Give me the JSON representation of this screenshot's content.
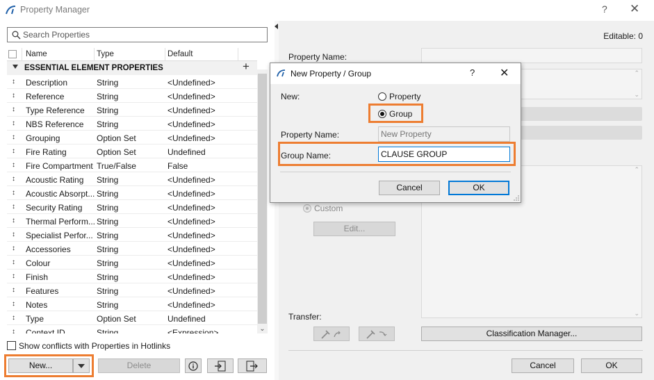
{
  "window": {
    "title": "Property Manager",
    "help_label": "?",
    "close_label": "✕"
  },
  "search": {
    "placeholder": "Search Properties"
  },
  "table": {
    "columns": {
      "name": "Name",
      "type": "Type",
      "default": "Default"
    },
    "group": {
      "label": "ESSENTIAL ELEMENT PROPERTIES",
      "add_label": "+"
    },
    "rows": [
      {
        "name": "Description",
        "type": "String",
        "default": "<Undefined>"
      },
      {
        "name": "Reference",
        "type": "String",
        "default": "<Undefined>"
      },
      {
        "name": "Type Reference",
        "type": "String",
        "default": "<Undefined>"
      },
      {
        "name": "NBS Reference",
        "type": "String",
        "default": "<Undefined>"
      },
      {
        "name": "Grouping",
        "type": "Option Set",
        "default": "<Undefined>"
      },
      {
        "name": "Fire Rating",
        "type": "Option Set",
        "default": "Undefined"
      },
      {
        "name": "Fire Compartment",
        "type": "True/False",
        "default": "False"
      },
      {
        "name": "Acoustic Rating",
        "type": "String",
        "default": "<Undefined>"
      },
      {
        "name": "Acoustic Absorpt...",
        "type": "String",
        "default": "<Undefined>"
      },
      {
        "name": "Security Rating",
        "type": "String",
        "default": "<Undefined>"
      },
      {
        "name": "Thermal Perform...",
        "type": "String",
        "default": "<Undefined>"
      },
      {
        "name": "Specialist Perfor...",
        "type": "String",
        "default": "<Undefined>"
      },
      {
        "name": "Accessories",
        "type": "String",
        "default": "<Undefined>"
      },
      {
        "name": "Colour",
        "type": "String",
        "default": "<Undefined>"
      },
      {
        "name": "Finish",
        "type": "String",
        "default": "<Undefined>"
      },
      {
        "name": "Features",
        "type": "String",
        "default": "<Undefined>"
      },
      {
        "name": "Notes",
        "type": "String",
        "default": "<Undefined>"
      },
      {
        "name": "Type",
        "type": "Option Set",
        "default": "Undefined"
      },
      {
        "name": "Context ID",
        "type": "String",
        "default": "<Expression>"
      }
    ]
  },
  "left_footer": {
    "conflicts_label": "Show conflicts with Properties in Hotlinks",
    "new_label": "New...",
    "delete_label": "Delete",
    "info_label": "i"
  },
  "right": {
    "editable": "Editable: 0",
    "property_name_label": "Property Name:",
    "custom_label": "Custom",
    "edit_label": "Edit...",
    "transfer_label": "Transfer:",
    "classification_label": "Classification Manager...",
    "cancel_label": "Cancel",
    "ok_label": "OK"
  },
  "dialog": {
    "title": "New Property / Group",
    "help_label": "?",
    "close_label": "✕",
    "new_label": "New:",
    "option_property": "Property",
    "option_group": "Group",
    "selected": "Group",
    "property_name_label": "Property Name:",
    "property_name_placeholder": "New Property",
    "group_name_label": "Group Name:",
    "group_name_value": "CLAUSE GROUP",
    "cancel_label": "Cancel",
    "ok_label": "OK"
  },
  "colors": {
    "highlight": "#ed7d31",
    "focus": "#0078d7",
    "logo": "#1e5fa8"
  }
}
